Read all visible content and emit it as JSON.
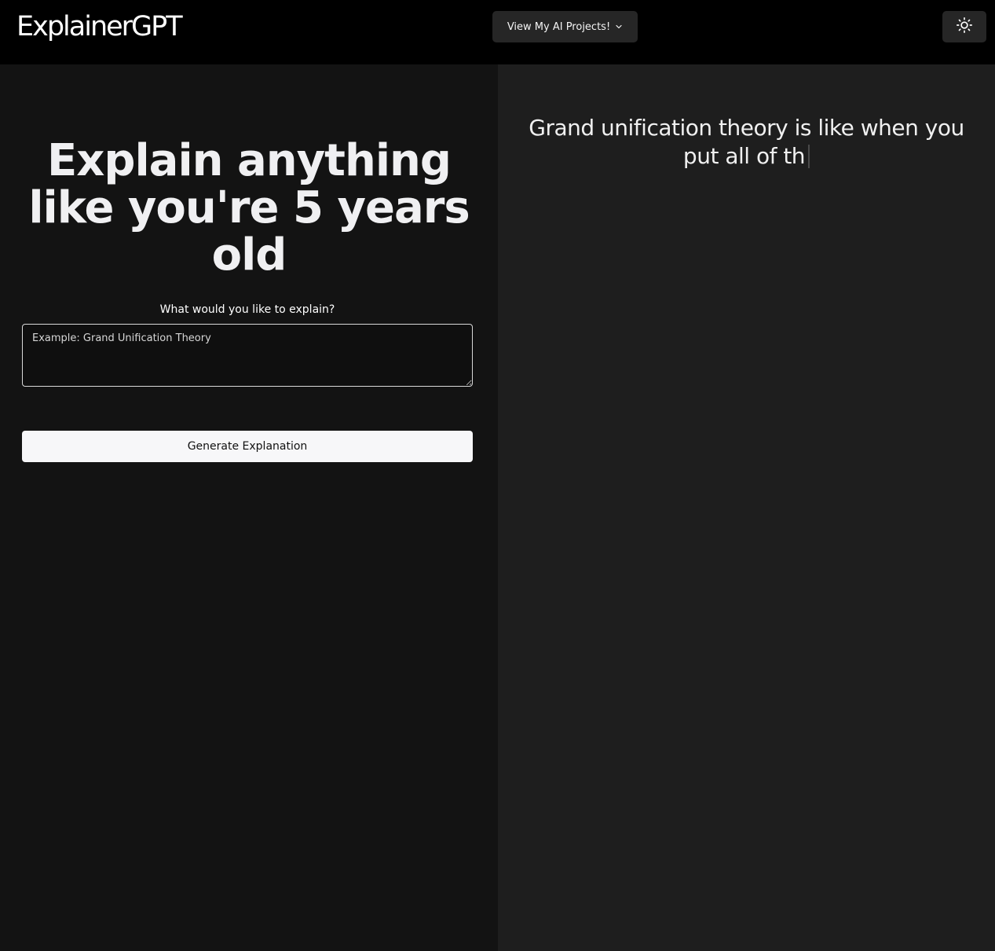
{
  "app": {
    "logo": "ExplainerGPT"
  },
  "header": {
    "projects_button_label": "View My AI Projects!",
    "projects_icon": "chevron-down-icon",
    "theme_icon": "sun-icon"
  },
  "main": {
    "headline": "Explain anything like you're 5 years old",
    "prompt_label": "What would you like to explain?",
    "input": {
      "placeholder": "Example: Grand Unification Theory",
      "value": ""
    },
    "generate_label": "Generate Explanation"
  },
  "output": {
    "text": "Grand unification theory is like when you put all of th"
  }
}
